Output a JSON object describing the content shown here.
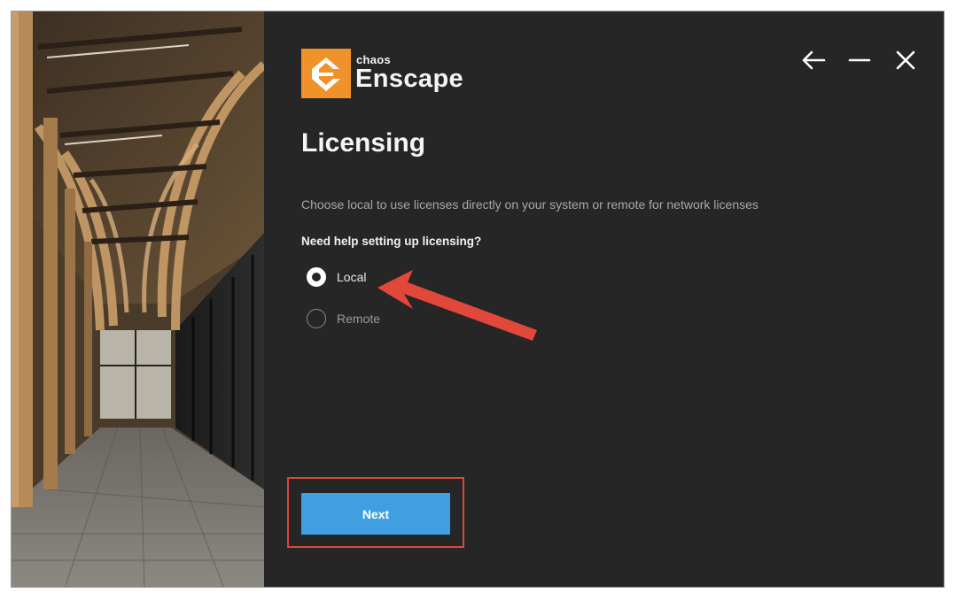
{
  "brand": {
    "company": "chaos",
    "product": "Enscape",
    "accent": "#f0922c"
  },
  "window_controls": {
    "back_icon": "arrow-left-icon",
    "minimize_icon": "minimize-icon",
    "close_icon": "close-icon"
  },
  "page": {
    "title": "Licensing",
    "subtitle": "Choose local to use licenses directly on your system or remote for network licenses",
    "help_link": "Need help setting up licensing?"
  },
  "options": [
    {
      "label": "Local",
      "selected": true
    },
    {
      "label": "Remote",
      "selected": false
    }
  ],
  "actions": {
    "next_label": "Next",
    "next_color": "#3f9fe0"
  },
  "annotations": {
    "arrow_color": "#e2483a",
    "highlight_color": "#d9473c"
  }
}
